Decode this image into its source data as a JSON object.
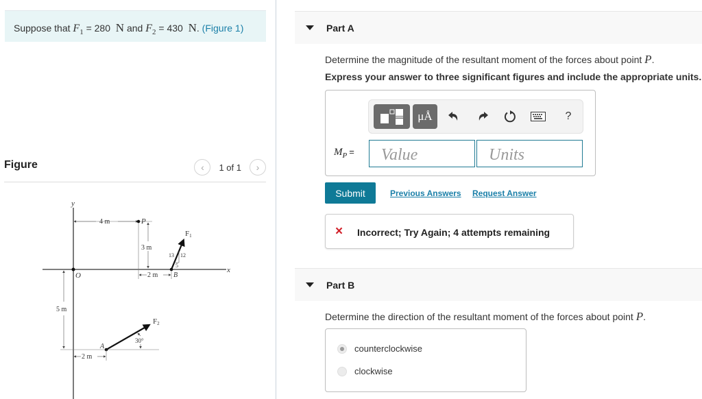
{
  "intro": {
    "prefix": "Suppose that",
    "f1_symbol": "F",
    "f1_sub": "1",
    "f1_value": "= 280",
    "f1_unit": "N",
    "and": "and",
    "f2_symbol": "F",
    "f2_sub": "2",
    "f2_value": "= 430",
    "f2_unit": "N",
    "suffix": ".",
    "figure_link": "(Figure 1)"
  },
  "figure": {
    "title": "Figure",
    "prev_icon": "chevron-left-icon",
    "next_icon": "chevron-right-icon",
    "pager": "1 of 1",
    "labels": {
      "y_axis": "y",
      "x_axis": "x",
      "origin": "O",
      "point_p": "P",
      "point_b": "B",
      "point_a": "A",
      "dim_4m": "4 m",
      "dim_3m": "3 m",
      "dim_2m_top": "2 m",
      "dim_5m": "5 m",
      "dim_2m_bottom": "2 m",
      "force1": "F",
      "force1_sub": "1",
      "force2": "F",
      "force2_sub": "2",
      "slope_13": "13",
      "slope_12": "12",
      "slope_5": "5",
      "angle": "30°"
    }
  },
  "part_a": {
    "title": "Part A",
    "question": "Determine the magnitude of the resultant moment of the forces about point",
    "point": "P",
    "period": ".",
    "instruction": "Express your answer to three significant figures and include the appropriate units.",
    "toolbar": {
      "templates_icon": "templates-icon",
      "units_label": "μÅ",
      "undo_icon": "undo-icon",
      "redo_icon": "redo-icon",
      "reset_icon": "reset-icon",
      "keyboard_icon": "keyboard-icon",
      "help_label": "?"
    },
    "answer_label": "M",
    "answer_sub": "P",
    "answer_eq": "=",
    "value_placeholder": "Value",
    "units_placeholder": "Units",
    "submit_label": "Submit",
    "previous_answers": "Previous Answers",
    "request_answer": "Request Answer",
    "feedback_icon": "×",
    "feedback": "Incorrect; Try Again; 4 attempts remaining",
    "colors": {
      "accent": "#0f7a97",
      "link": "#1a7fa8",
      "error": "#d11f28"
    }
  },
  "part_b": {
    "title": "Part B",
    "question": "Determine the direction of the resultant moment of the forces about point",
    "point": "P",
    "period": ".",
    "options": [
      {
        "label": "counterclockwise",
        "selected": true
      },
      {
        "label": "clockwise",
        "selected": false
      }
    ]
  }
}
